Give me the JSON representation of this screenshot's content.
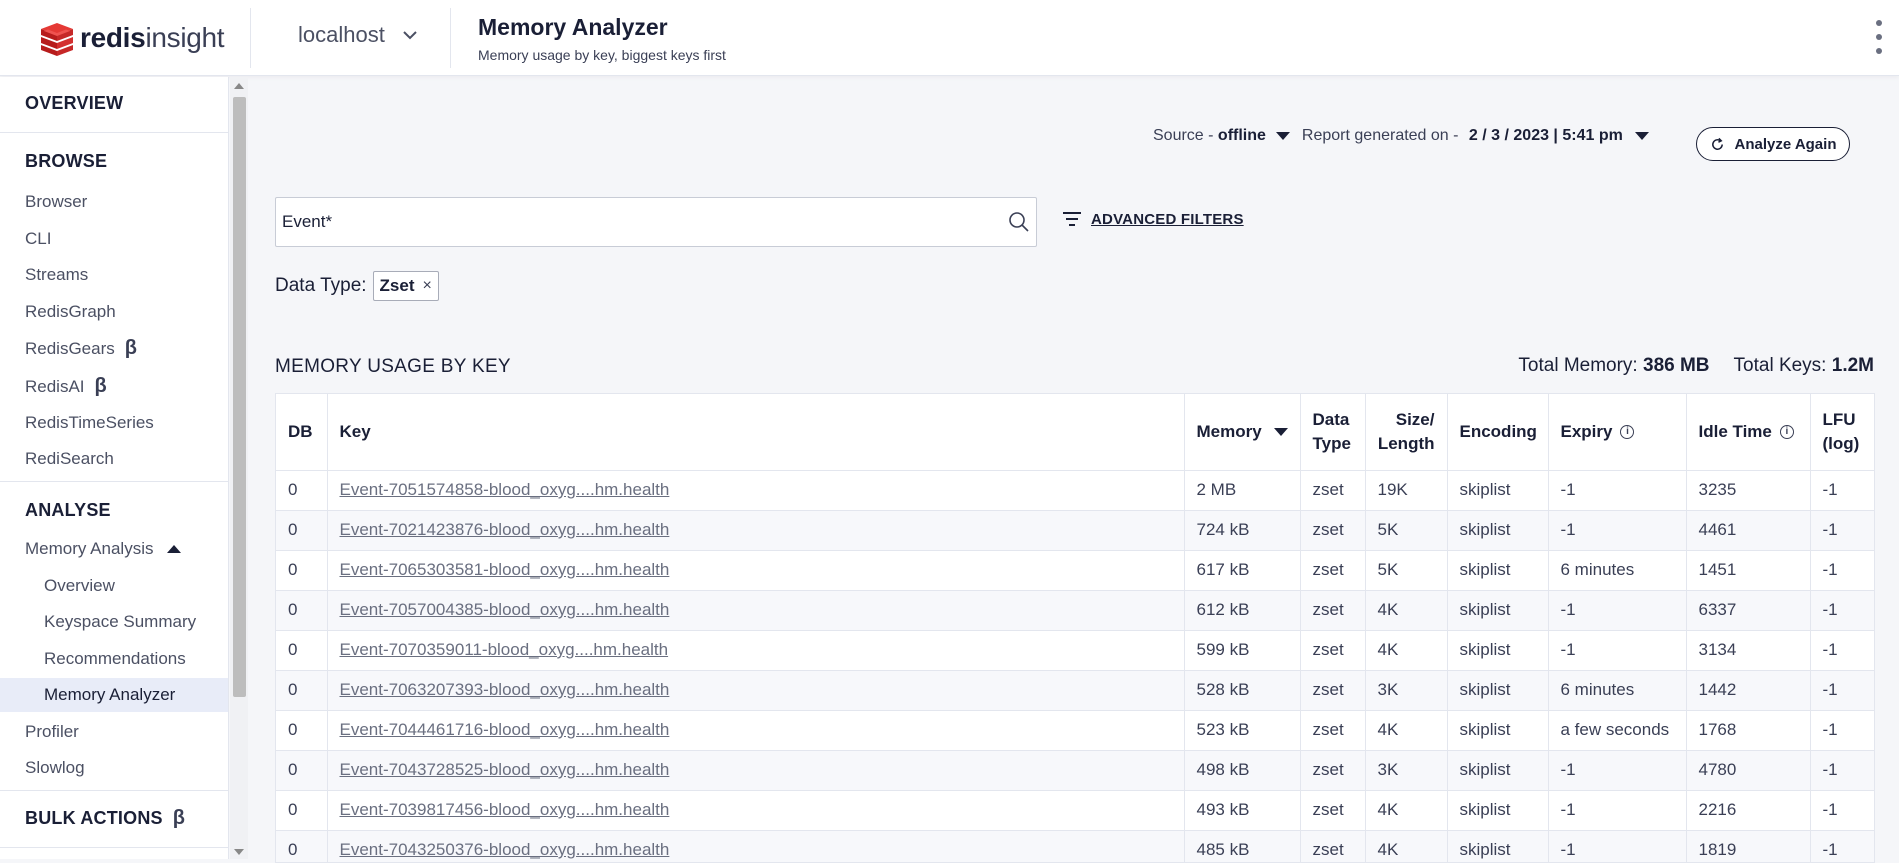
{
  "app": {
    "logo_bold": "redis",
    "logo_light": "insight",
    "database": "localhost",
    "page_title": "Memory Analyzer",
    "page_subtitle": "Memory usage by key, biggest keys first"
  },
  "sidebar": {
    "overview": "OVERVIEW",
    "browse": {
      "heading": "BROWSE",
      "items": [
        "Browser",
        "CLI",
        "Streams",
        "RedisGraph",
        "RedisGears",
        "RedisAI",
        "RedisTimeSeries",
        "RediSearch"
      ],
      "beta_mark": "β"
    },
    "analyse": {
      "heading": "ANALYSE",
      "memory_analysis": "Memory Analysis",
      "sub_items": [
        "Overview",
        "Keyspace Summary",
        "Recommendations",
        "Memory Analyzer"
      ],
      "active": "Memory Analyzer",
      "items_after": [
        "Profiler",
        "Slowlog"
      ]
    },
    "bulk_actions": "BULK ACTIONS"
  },
  "report": {
    "source_label": "Source -",
    "source_value": "offline",
    "generated_label": "Report generated on -",
    "generated_value": "2 / 3 / 2023 | 5:41 pm",
    "analyze_button": "Analyze Again"
  },
  "search": {
    "value": "Event*",
    "advanced_filters": "ADVANCED FILTERS"
  },
  "filter": {
    "label": "Data Type:",
    "chip": "Zset",
    "chip_remove": "×"
  },
  "memory_usage": {
    "heading": "MEMORY USAGE BY KEY",
    "total_memory_label": "Total Memory:",
    "total_memory_value": "386 MB",
    "total_keys_label": "Total Keys:",
    "total_keys_value": "1.2M"
  },
  "table": {
    "columns": {
      "db": "DB",
      "key": "Key",
      "memory": "Memory",
      "data_type_1": "Data",
      "data_type_2": "Type",
      "size_1": "Size/",
      "size_2": "Length",
      "encoding": "Encoding",
      "expiry": "Expiry",
      "idle_time": "Idle Time",
      "lfu_1": "LFU",
      "lfu_2": "(log)"
    },
    "info_glyph": "i",
    "rows": [
      {
        "db": "0",
        "key": "Event-7051574858-blood_oxyg....hm.health",
        "memory": "2 MB",
        "type": "zset",
        "size": "19K",
        "encoding": "skiplist",
        "expiry": "-1",
        "idle": "3235",
        "lfu": "-1"
      },
      {
        "db": "0",
        "key": "Event-7021423876-blood_oxyg....hm.health",
        "memory": "724 kB",
        "type": "zset",
        "size": "5K",
        "encoding": "skiplist",
        "expiry": "-1",
        "idle": "4461",
        "lfu": "-1"
      },
      {
        "db": "0",
        "key": "Event-7065303581-blood_oxyg....hm.health",
        "memory": "617 kB",
        "type": "zset",
        "size": "5K",
        "encoding": "skiplist",
        "expiry": "6 minutes",
        "idle": "1451",
        "lfu": "-1"
      },
      {
        "db": "0",
        "key": "Event-7057004385-blood_oxyg....hm.health",
        "memory": "612 kB",
        "type": "zset",
        "size": "4K",
        "encoding": "skiplist",
        "expiry": "-1",
        "idle": "6337",
        "lfu": "-1"
      },
      {
        "db": "0",
        "key": "Event-7070359011-blood_oxyg....hm.health",
        "memory": "599 kB",
        "type": "zset",
        "size": "4K",
        "encoding": "skiplist",
        "expiry": "-1",
        "idle": "3134",
        "lfu": "-1"
      },
      {
        "db": "0",
        "key": "Event-7063207393-blood_oxyg....hm.health",
        "memory": "528 kB",
        "type": "zset",
        "size": "3K",
        "encoding": "skiplist",
        "expiry": "6 minutes",
        "idle": "1442",
        "lfu": "-1"
      },
      {
        "db": "0",
        "key": "Event-7044461716-blood_oxyg....hm.health",
        "memory": "523 kB",
        "type": "zset",
        "size": "4K",
        "encoding": "skiplist",
        "expiry": "a few seconds",
        "idle": "1768",
        "lfu": "-1"
      },
      {
        "db": "0",
        "key": "Event-7043728525-blood_oxyg....hm.health",
        "memory": "498 kB",
        "type": "zset",
        "size": "3K",
        "encoding": "skiplist",
        "expiry": "-1",
        "idle": "4780",
        "lfu": "-1"
      },
      {
        "db": "0",
        "key": "Event-7039817456-blood_oxyg....hm.health",
        "memory": "493 kB",
        "type": "zset",
        "size": "4K",
        "encoding": "skiplist",
        "expiry": "-1",
        "idle": "2216",
        "lfu": "-1"
      },
      {
        "db": "0",
        "key": "Event-7043250376-blood_oxyg....hm.health",
        "memory": "485 kB",
        "type": "zset",
        "size": "4K",
        "encoding": "skiplist",
        "expiry": "-1",
        "idle": "1819",
        "lfu": "-1"
      }
    ]
  },
  "colors": {
    "brand_red": "#d32f2f",
    "text_dark": "#1a1f36",
    "active_bg": "#e8ecf8"
  }
}
